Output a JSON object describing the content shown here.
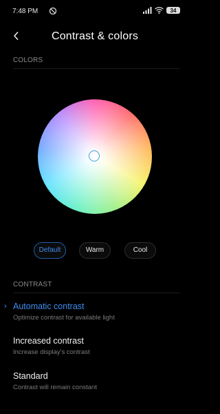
{
  "status_bar": {
    "time": "7:48 PM",
    "battery": "34"
  },
  "header": {
    "title": "Contrast & colors",
    "back_icon": "chevron-left-icon"
  },
  "colors_section": {
    "label": "COLORS"
  },
  "presets": [
    {
      "label": "Default",
      "selected": true
    },
    {
      "label": "Warm",
      "selected": false
    },
    {
      "label": "Cool",
      "selected": false
    }
  ],
  "contrast_section": {
    "label": "CONTRAST"
  },
  "options": [
    {
      "title": "Automatic contrast",
      "subtitle": "Optimize contrast for available light",
      "selected": true
    },
    {
      "title": "Increased contrast",
      "subtitle": "Increase display's contrast",
      "selected": false
    },
    {
      "title": "Standard",
      "subtitle": "Contrast will remain constant",
      "selected": false
    }
  ],
  "colors": {
    "accent": "#3e8ef0",
    "background": "#000000"
  }
}
